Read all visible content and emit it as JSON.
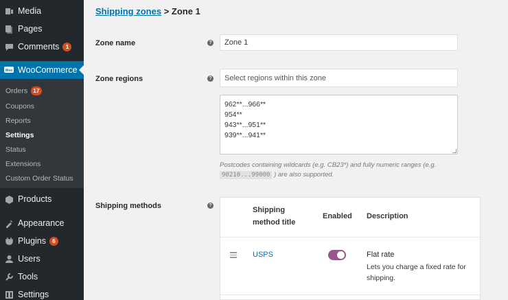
{
  "sidebar": {
    "items": [
      {
        "label": "Media",
        "icon": "media-icon"
      },
      {
        "label": "Pages",
        "icon": "pages-icon"
      },
      {
        "label": "Comments",
        "icon": "comments-icon",
        "badge": "1"
      },
      {
        "label": "WooCommerce",
        "icon": "woocommerce-icon"
      },
      {
        "label": "Products",
        "icon": "products-icon"
      },
      {
        "label": "Appearance",
        "icon": "appearance-icon"
      },
      {
        "label": "Plugins",
        "icon": "plugins-icon",
        "badge": "6"
      },
      {
        "label": "Users",
        "icon": "users-icon"
      },
      {
        "label": "Tools",
        "icon": "tools-icon"
      },
      {
        "label": "Settings",
        "icon": "settings-icon"
      }
    ],
    "woo_logo": "Woo",
    "submenu": [
      {
        "label": "Orders",
        "badge": "17"
      },
      {
        "label": "Coupons"
      },
      {
        "label": "Reports"
      },
      {
        "label": "Settings",
        "current": true
      },
      {
        "label": "Status"
      },
      {
        "label": "Extensions"
      },
      {
        "label": "Custom Order Status"
      }
    ]
  },
  "breadcrumb": {
    "link": "Shipping zones",
    "separator": ">",
    "current": "Zone 1"
  },
  "form": {
    "zone_name_label": "Zone name",
    "zone_name_value": "Zone 1",
    "zone_regions_label": "Zone regions",
    "zone_regions_placeholder": "Select regions within this zone",
    "postcodes": [
      "962**...966**",
      "954**",
      "943**...951**",
      "939**...941**"
    ],
    "hint_part1": "Postcodes containing wildcards (e.g. CB23*) and fully numeric ranges (e.g.",
    "hint_code": "90210...99000",
    "hint_part2": ") are also supported.",
    "shipping_methods_label": "Shipping methods",
    "help_glyph": "?"
  },
  "methods_table": {
    "headers": {
      "title_line1": "Shipping",
      "title_line2": "method title",
      "enabled": "Enabled",
      "description": "Description"
    },
    "rows": [
      {
        "title": "USPS",
        "enabled": true,
        "method_name": "Flat rate",
        "method_desc": "Lets you charge a fixed rate for shipping."
      }
    ]
  },
  "colors": {
    "sidebar_bg": "#23282d",
    "active_menu": "#0073aa",
    "toggle_on": "#96588a",
    "badge": "#d54e21",
    "link": "#0073aa"
  }
}
